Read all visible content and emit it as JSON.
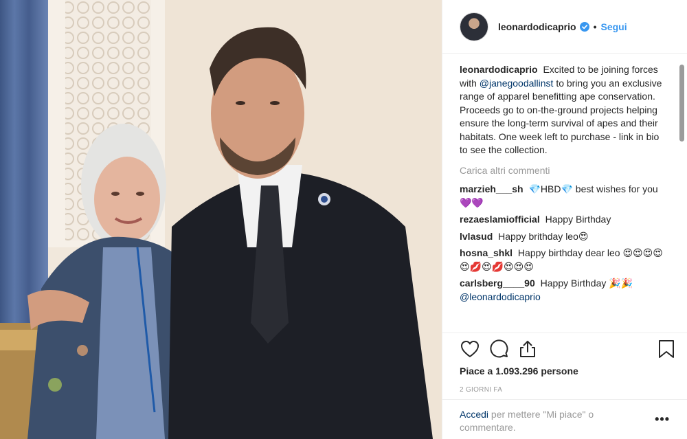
{
  "photo": {
    "alt": "",
    "icon": "post-photo"
  },
  "header": {
    "username": "leonardodicaprio",
    "separator": "•",
    "follow_label": "Segui"
  },
  "caption": {
    "username": "leonardodicaprio",
    "text_before": "Excited to be joining forces with",
    "mention": "@janegoodallinst",
    "text_after": "to bring you an exclusive range of apparel benefitting ape conservation. Proceeds go to on-the-ground projects helping ensure the long-term survival of apes and their habitats. One week left to purchase - link in bio to see the collection."
  },
  "load_more": "Carica altri commenti",
  "comments": [
    {
      "username": "marzieh___sh",
      "text": "💎HBD💎 best wishes for you💜💜"
    },
    {
      "username": "rezaeslamiofficial",
      "text": "Happy Birthday"
    },
    {
      "username": "lvlasud",
      "text": "Happy brithday leo😍"
    },
    {
      "username": "hosna_shkl",
      "text": "Happy birthday dear leo 😍😍😍😍😍💋😍💋😍😍😍"
    },
    {
      "username": "carlsberg____90",
      "text": "Happy Birthday 🎉🎉",
      "mention": "@leonardodicaprio"
    }
  ],
  "likes": "Piace a 1.093.296 persone",
  "timestamp": "2 GIORNI FA",
  "login": {
    "link": "Accedi",
    "text": "per mettere \"Mi piace\" o commentare."
  },
  "more_label": "•••",
  "colors": {
    "link_blue": "#3897f0",
    "mention_blue": "#003569",
    "muted": "#999999",
    "text": "#262626",
    "border": "#efefef"
  },
  "icons": [
    "heart-icon",
    "comment-icon",
    "share-icon",
    "bookmark-icon",
    "verified-badge-icon",
    "more-options-icon"
  ]
}
